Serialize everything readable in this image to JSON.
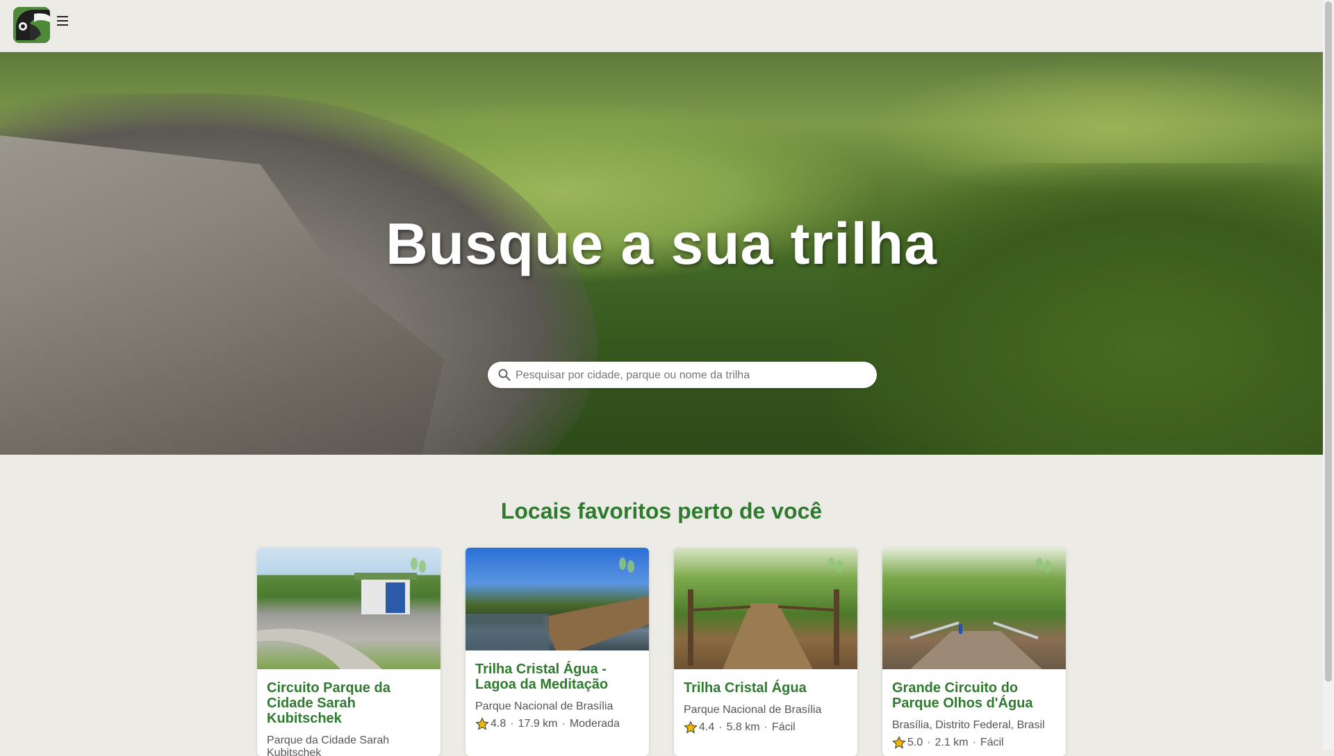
{
  "header": {
    "logo_icon": "toucan-logo-icon",
    "menu_icon": "hamburger-menu-icon"
  },
  "hero": {
    "title": "Busque a sua trilha",
    "search_placeholder": "Pesquisar por cidade, parque ou nome da trilha",
    "search_value": ""
  },
  "favorites": {
    "heading": "Locais favoritos perto de você",
    "cards": [
      {
        "title": "Circuito Parque da Cidade Sarah Kubitschek",
        "location": "Parque da Cidade Sarah Kubitschek",
        "rating": "",
        "distance": "",
        "difficulty": ""
      },
      {
        "title": "Trilha Cristal Água - Lagoa da Meditação",
        "location": "Parque Nacional de Brasília",
        "rating": "4.8",
        "distance": "17.9 km",
        "difficulty": "Moderada"
      },
      {
        "title": "Trilha Cristal Água",
        "location": "Parque Nacional de Brasília",
        "rating": "4.4",
        "distance": "5.8 km",
        "difficulty": "Fácil"
      },
      {
        "title": "Grande Circuito do Parque Olhos d'Água",
        "location": "Brasília, Distrito Federal, Brasil",
        "rating": "5.0",
        "distance": "2.1 km",
        "difficulty": "Fácil"
      }
    ]
  },
  "colors": {
    "accent_green": "#2f7a2f",
    "background": "#ecebe6",
    "star": "#f2b705"
  }
}
